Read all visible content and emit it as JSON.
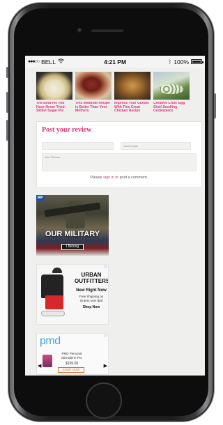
{
  "status_bar": {
    "carrier": "BELL",
    "signal_dots": "●●●○○",
    "time": "4:21 PM",
    "battery": "100%"
  },
  "recipes": [
    {
      "title": "The Best Pie You Have Never Tried: Skillet Sugar Pie",
      "image": "sugar-pie"
    },
    {
      "title": "This Meatloaf Recipe is Better Than Your Mothers",
      "image": "meatloaf"
    },
    {
      "title": "Impress Your Guests With This Great Chicken Recipe",
      "image": "chicken"
    },
    {
      "title": "Creative Craft: Egg Shell Seedling Centerpiece",
      "image": "egg-shell-seedlings"
    }
  ],
  "review": {
    "title": "Post your review",
    "email_placeholder": "Your E-mail",
    "review_placeholder": "Your Review",
    "signin_prefix": "Please ",
    "signin_link": "sign in",
    "signin_suffix": " to post a comment."
  },
  "ads": {
    "military": {
      "badge": "RP",
      "headline": "OUR MILITARY",
      "button": "I Belong"
    },
    "urban": {
      "brand": "URBAN OUTFITTERS",
      "headline": "New Right Now",
      "shipping": "Free Shipping on Orders over $50",
      "cta": "Shop Now",
      "adchoices": "▷"
    },
    "pmd": {
      "logo": "pmd",
      "product": "PMD Personal Microderm Pro",
      "price": "$199.00",
      "cta": "SHOP NOW",
      "adchoices": "▷"
    }
  },
  "colors": {
    "accent_pink": "#e0347a",
    "screen_background": "#efefed"
  }
}
